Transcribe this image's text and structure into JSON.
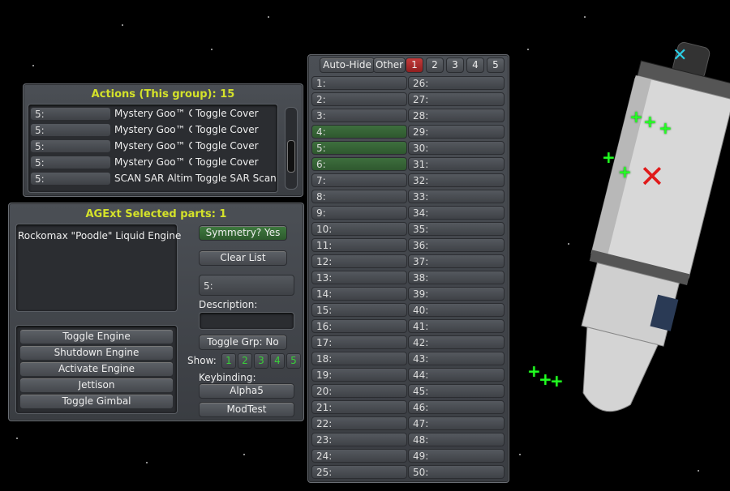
{
  "actions_panel": {
    "title": "Actions (This group): 15",
    "rows": [
      {
        "group": "5:",
        "part": "Mystery Goo™ C",
        "action": "Toggle Cover"
      },
      {
        "group": "5:",
        "part": "Mystery Goo™ C",
        "action": "Toggle Cover"
      },
      {
        "group": "5:",
        "part": "Mystery Goo™ C",
        "action": "Toggle Cover"
      },
      {
        "group": "5:",
        "part": "Mystery Goo™ C",
        "action": "Toggle Cover"
      },
      {
        "group": "5:",
        "part": "SCAN SAR Altim",
        "action": "Toggle SAR Scan"
      }
    ]
  },
  "selected_panel": {
    "title": "AGExt Selected parts: 1",
    "parts": [
      "Rockomax \"Poodle\" Liquid Engine"
    ],
    "symmetry_label": "Symmetry? Yes",
    "clear_label": "Clear List",
    "group_field": "5:",
    "description_label": "Description:",
    "description_value": "",
    "toggle_grp_label": "Toggle Grp: No",
    "show_label": "Show:",
    "show_numbers": [
      "1",
      "2",
      "3",
      "4",
      "5"
    ],
    "keybinding_label": "Keybinding:",
    "keybinding_value": "Alpha5",
    "modtest_label": "ModTest",
    "actions": [
      "Toggle Engine",
      "Shutdown Engine",
      "Activate Engine",
      "Jettison",
      "Toggle Gimbal"
    ]
  },
  "groups_panel": {
    "autohide_label": "Auto-Hide",
    "other_label": "Other",
    "tabs": [
      "1",
      "2",
      "3",
      "4",
      "5"
    ],
    "selected_tab": "1",
    "left_column": [
      "1:",
      "2:",
      "3:",
      "4:",
      "5:",
      "6:",
      "7:",
      "8:",
      "9:",
      "10:",
      "11:",
      "12:",
      "13:",
      "14:",
      "15:",
      "16:",
      "17:",
      "18:",
      "19:",
      "20:",
      "21:",
      "22:",
      "23:",
      "24:",
      "25:"
    ],
    "right_column": [
      "26:",
      "27:",
      "28:",
      "29:",
      "30:",
      "31:",
      "32:",
      "33:",
      "34:",
      "35:",
      "36:",
      "37:",
      "38:",
      "39:",
      "40:",
      "41:",
      "42:",
      "43:",
      "44:",
      "45:",
      "46:",
      "47:",
      "48:",
      "49:",
      "50:"
    ],
    "active_groups": [
      "4:",
      "5:",
      "6:"
    ]
  },
  "colors": {
    "title_yellow": "#d4e22a",
    "active_green": "#3e6f3e",
    "selected_tab_red": "#b02a2a",
    "show_number_green": "#39d039"
  }
}
